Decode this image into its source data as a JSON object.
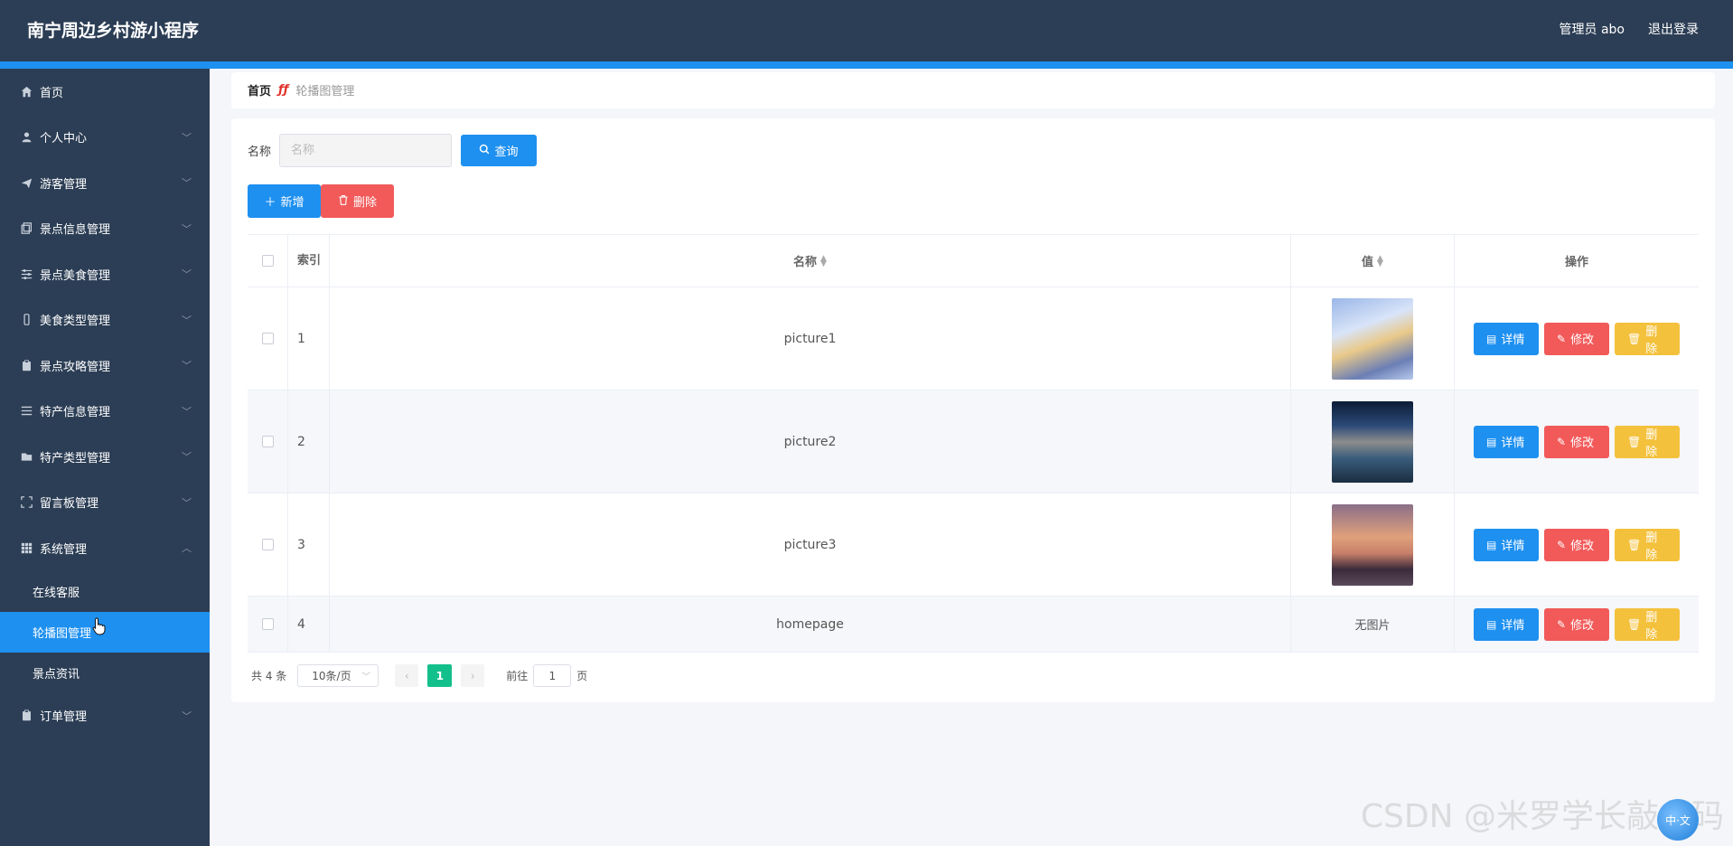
{
  "header": {
    "title": "南宁周边乡村游小程序",
    "user": "管理员 abo",
    "logout": "退出登录"
  },
  "sidebar": {
    "items": [
      {
        "label": "首页",
        "icon": "home-icon"
      },
      {
        "label": "个人中心",
        "icon": "user-icon"
      },
      {
        "label": "游客管理",
        "icon": "send-icon"
      },
      {
        "label": "景点信息管理",
        "icon": "copy-icon"
      },
      {
        "label": "景点美食管理",
        "icon": "sliders-icon"
      },
      {
        "label": "美食类型管理",
        "icon": "phone-icon"
      },
      {
        "label": "景点攻略管理",
        "icon": "clipboard-icon"
      },
      {
        "label": "特产信息管理",
        "icon": "list-icon"
      },
      {
        "label": "特产类型管理",
        "icon": "folder-icon"
      },
      {
        "label": "留言板管理",
        "icon": "fullscreen-icon"
      },
      {
        "label": "系统管理",
        "icon": "grid-icon"
      },
      {
        "label": "订单管理",
        "icon": "clipboard-icon"
      }
    ],
    "sub_items": [
      "在线客服",
      "轮播图管理",
      "景点资讯"
    ]
  },
  "breadcrumb": {
    "home": "首页",
    "current": "轮播图管理"
  },
  "search": {
    "label": "名称",
    "placeholder": "名称",
    "query_label": "查询"
  },
  "actions": {
    "add_label": "新增",
    "delete_label": "删除"
  },
  "table": {
    "headers": {
      "index": "索引",
      "name": "名称",
      "value": "值",
      "operation": "操作"
    },
    "rows": [
      {
        "index": "1",
        "name": "picture1",
        "value": "",
        "has_image": true
      },
      {
        "index": "2",
        "name": "picture2",
        "value": "",
        "has_image": true
      },
      {
        "index": "3",
        "name": "picture3",
        "value": "",
        "has_image": true
      },
      {
        "index": "4",
        "name": "homepage",
        "value": "无图片",
        "has_image": false
      }
    ],
    "ops": {
      "detail": "详情",
      "edit": "修改",
      "delete": "删除"
    }
  },
  "pager": {
    "total": "共 4 条",
    "page_size": "10条/页",
    "current_page": "1",
    "goto_label": "前往",
    "goto_value": "1",
    "page_unit": "页"
  },
  "watermark": "CSDN @米罗学长敲代码",
  "float_button": "中·文",
  "colors": {
    "header_bg": "#2c3e55",
    "accent": "#1e90f0",
    "danger": "#f25a5a",
    "warning": "#f4c13c",
    "success": "#13c08b"
  }
}
